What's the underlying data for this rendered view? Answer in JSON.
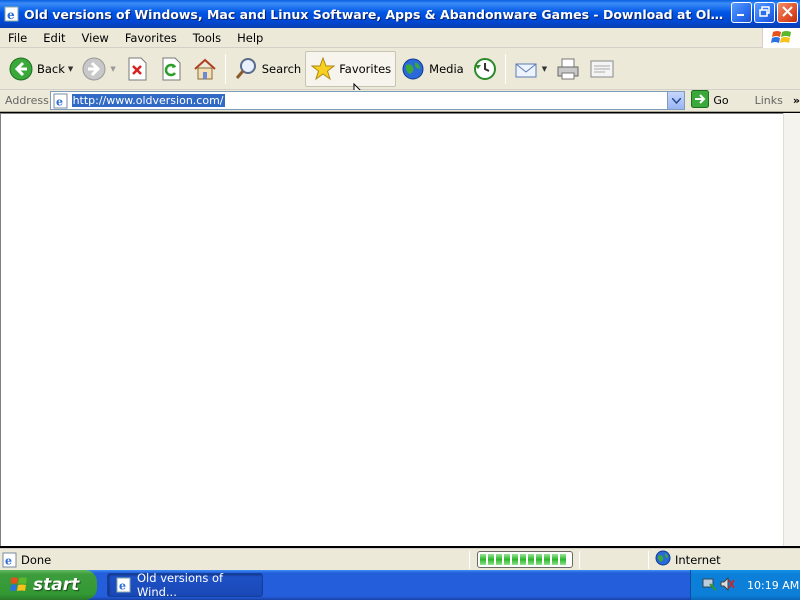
{
  "window": {
    "title": "Old versions of Windows, Mac and Linux Software, Apps & Abandonware Games - Download at OldVers - Microso...",
    "controls": [
      "minimize",
      "restore",
      "close"
    ]
  },
  "menu": {
    "items": [
      "File",
      "Edit",
      "View",
      "Favorites",
      "Tools",
      "Help"
    ]
  },
  "toolbar": {
    "back_label": "Back",
    "search_label": "Search",
    "favorites_label": "Favorites",
    "media_label": "Media"
  },
  "address": {
    "label": "Address",
    "url": "http://www.oldversion.com/",
    "go_label": "Go",
    "links_label": "Links",
    "chevron": "»"
  },
  "status": {
    "text": "Done",
    "zone": "Internet",
    "progress_segments": 11
  },
  "taskbar": {
    "start_label": "start",
    "task_label": "Old versions of Wind...",
    "clock": "10:19 AM"
  },
  "colors": {
    "titlebar": "#0055e5",
    "chrome": "#ece9d8",
    "taskbar": "#245edb",
    "start": "#339933",
    "tray": "#0c7fd8",
    "selection": "#316ac5"
  }
}
